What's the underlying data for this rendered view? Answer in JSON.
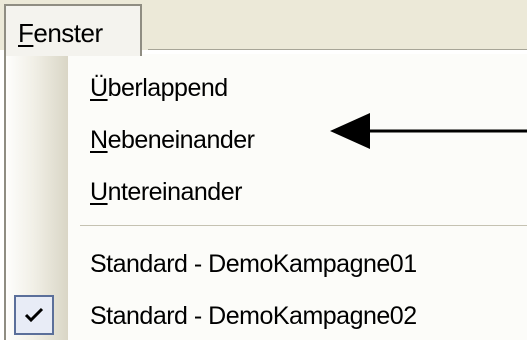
{
  "menubar": {
    "title_prefix": "F",
    "title_rest": "enster"
  },
  "menu": {
    "items": [
      {
        "mnemonic": "Ü",
        "rest": "berlappend"
      },
      {
        "mnemonic": "N",
        "rest": "ebeneinander"
      },
      {
        "mnemonic": "U",
        "rest": "ntereinander"
      }
    ],
    "windows": [
      {
        "label": "Standard - DemoKampagne01",
        "checked": false
      },
      {
        "label": "Standard - DemoKampagne02",
        "checked": true
      }
    ]
  },
  "annotation": {
    "arrow_color": "#000000"
  },
  "colors": {
    "menubar": "#ece9d8",
    "menu_background": "#fcfcf9",
    "check_highlight": "#e8ecf6",
    "check_border": "#5b6f9a"
  },
  "icons": [
    "checkmark-icon",
    "arrow-left-icon"
  ]
}
